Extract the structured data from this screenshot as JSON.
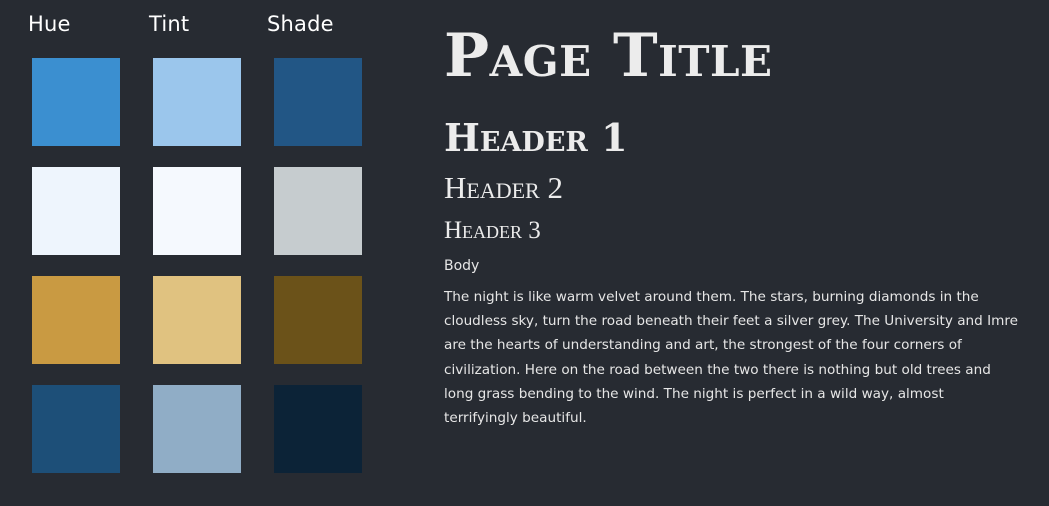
{
  "palette": {
    "columns": [
      "Hue",
      "Tint",
      "Shade"
    ],
    "rows": [
      {
        "hue": "#3b8fd0",
        "tint": "#9bc6ec",
        "shade": "#225685"
      },
      {
        "hue": "#eef5fd",
        "tint": "#f5f9fe",
        "shade": "#c6cccf"
      },
      {
        "hue": "#c99a42",
        "tint": "#e0c280",
        "shade": "#6b5219"
      },
      {
        "hue": "#1d4f78",
        "tint": "#90adc6",
        "shade": "#0c2337"
      }
    ]
  },
  "typography": {
    "page_title": "Page Title",
    "header1": "Header 1",
    "header2": "Header 2",
    "header3": "Header 3",
    "body_label": "Body",
    "body_text": "The night is like warm velvet around them. The stars, burning diamonds in the cloudless sky, turn the road beneath their feet a silver grey. The University and Imre are the hearts of understanding and art, the strongest of the four corners of civilization. Here on the road between the two there is nothing but old trees and long grass bending to the wind. The night is perfect in a wild way, almost terrifyingly beautiful."
  },
  "colors": {
    "background": "#272b32",
    "text": "#ececec"
  }
}
